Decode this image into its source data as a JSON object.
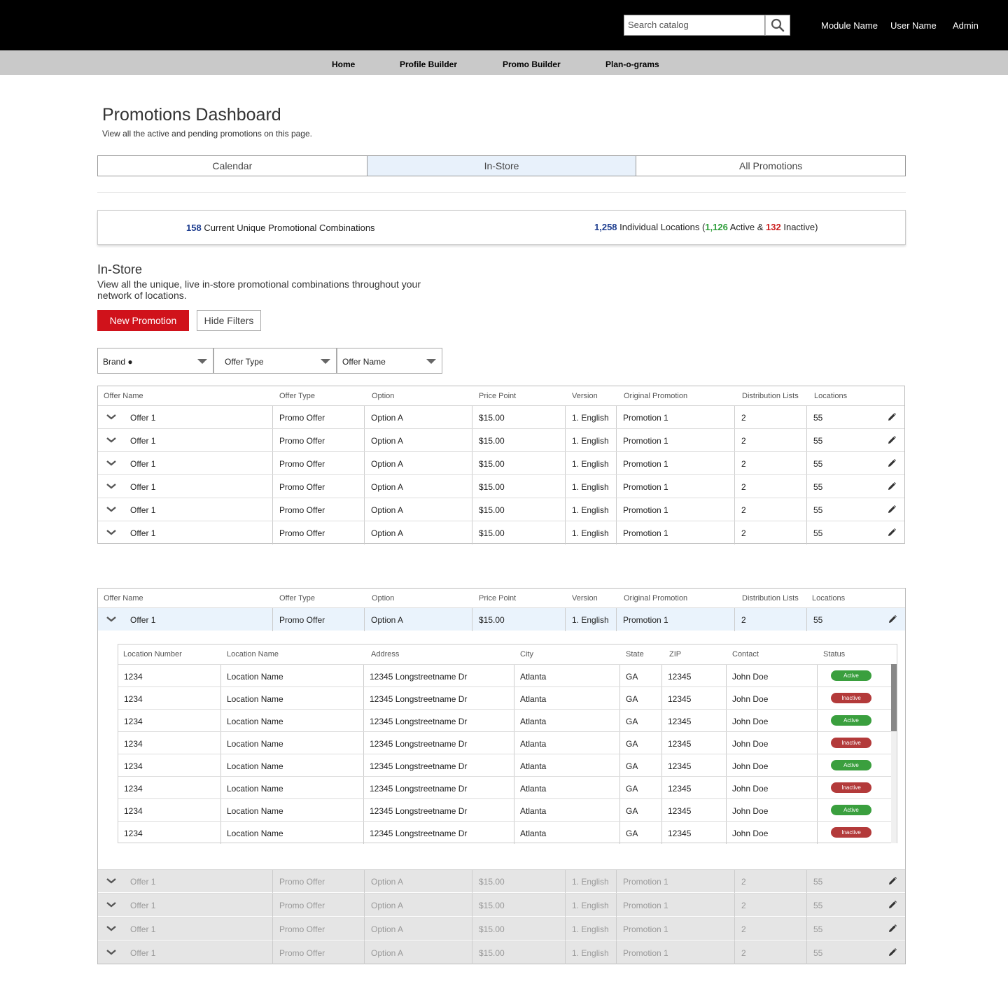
{
  "header": {
    "search_placeholder": "Search catalog",
    "module_name": "Module Name",
    "user_name": "User Name",
    "admin": "Admin"
  },
  "nav": {
    "items": [
      "Home",
      "Profile Builder",
      "Promo Builder",
      "Plan-o-grams"
    ]
  },
  "page": {
    "title": "Promotions Dashboard",
    "subtitle": "View all the active and pending promotions on this page."
  },
  "tabs": [
    "Calendar",
    "In-Store",
    "All Promotions"
  ],
  "summary": {
    "combos_count": "158",
    "combos_label": " Current Unique Promotional Combinations",
    "locations_count": "1,258",
    "locations_label": " Individual Locations (",
    "active_count": "1,126",
    "active_label": " Active & ",
    "inactive_count": "132",
    "inactive_label": " Inactive)"
  },
  "section": {
    "title": "In-Store",
    "description": "View all the unique, live in-store promotional combinations throughout your network of locations.",
    "new_promotion": "New Promotion",
    "hide_filters": "Hide Filters"
  },
  "filters": {
    "brand": "Brand ●",
    "offer_type": "Offer Type",
    "offer_name": "Offer Name"
  },
  "columns": [
    "Offer Name",
    "Offer Type",
    "Option",
    "Price Point",
    "Version",
    "Original Promotion",
    "Distribution Lists",
    "Locations"
  ],
  "row": {
    "offer_name": "Offer 1",
    "offer_type": "Promo Offer",
    "option": "Option A",
    "price": "$15.00",
    "version": "1. English",
    "original": "Promotion 1",
    "dist": "2",
    "locations": "55"
  },
  "loc_columns": [
    "Location Number",
    "Location Name",
    "Address",
    "City",
    "State",
    "ZIP",
    "Contact",
    "Status"
  ],
  "loc_row": {
    "number": "1234",
    "name": "Location Name",
    "address": "12345 Longstreetname Dr",
    "city": "Atlanta",
    "state": "GA",
    "zip": "12345",
    "contact": "John Doe"
  },
  "statuses": [
    "Active",
    "Inactive",
    "Active",
    "Inactive",
    "Active",
    "Inactive",
    "Active",
    "Inactive"
  ],
  "colors": {
    "accent": "#d0121b",
    "active": "#3a9f3e",
    "inactive": "#b33a3a",
    "count_blue": "#1d3d8f"
  }
}
